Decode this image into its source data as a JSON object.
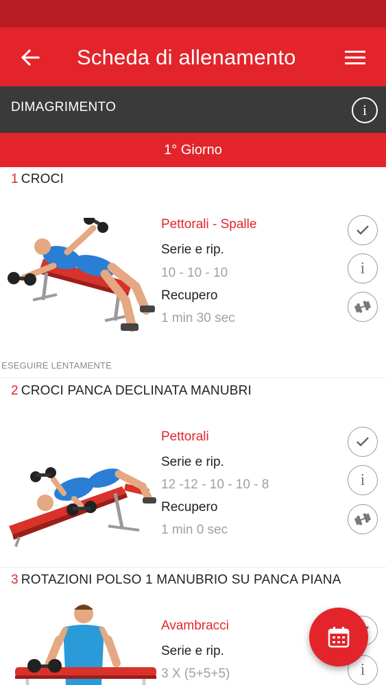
{
  "app_bar": {
    "title": "Scheda di allenamento"
  },
  "program": {
    "name": "DIMAGRIMENTO"
  },
  "day": {
    "label": "1° Giorno"
  },
  "exercises": [
    {
      "number": "1",
      "name": "CROCI",
      "muscle": "Pettorali - Spalle",
      "sets_label": "Serie e rip.",
      "sets_value": "10 - 10 - 10",
      "rest_label": "Recupero",
      "rest_value": "1 min 30 sec",
      "note": "ESEGUIRE LENTAMENTE"
    },
    {
      "number": "2",
      "name": "CROCI PANCA DECLINATA MANUBRI",
      "muscle": "Pettorali",
      "sets_label": "Serie e rip.",
      "sets_value": "12 -12 - 10 - 10 - 8",
      "rest_label": "Recupero",
      "rest_value": "1 min 0 sec"
    },
    {
      "number": "3",
      "name": "ROTAZIONI POLSO 1 MANUBRIO SU PANCA PIANA",
      "muscle": "Avambracci",
      "sets_label": "Serie e rip.",
      "sets_value": "3 X (5+5+5)"
    }
  ],
  "icons": {
    "back": "arrow-left-icon",
    "menu": "hamburger-menu-icon",
    "info": "info-icon",
    "done": "checkmark-icon",
    "weights": "dumbbell-icon",
    "calendar": "calendar-icon"
  },
  "colors": {
    "primary": "#e3242b",
    "status_bar": "#b71c22",
    "program_bar": "#3a3a3a",
    "muted_text": "#a0a0a0"
  }
}
